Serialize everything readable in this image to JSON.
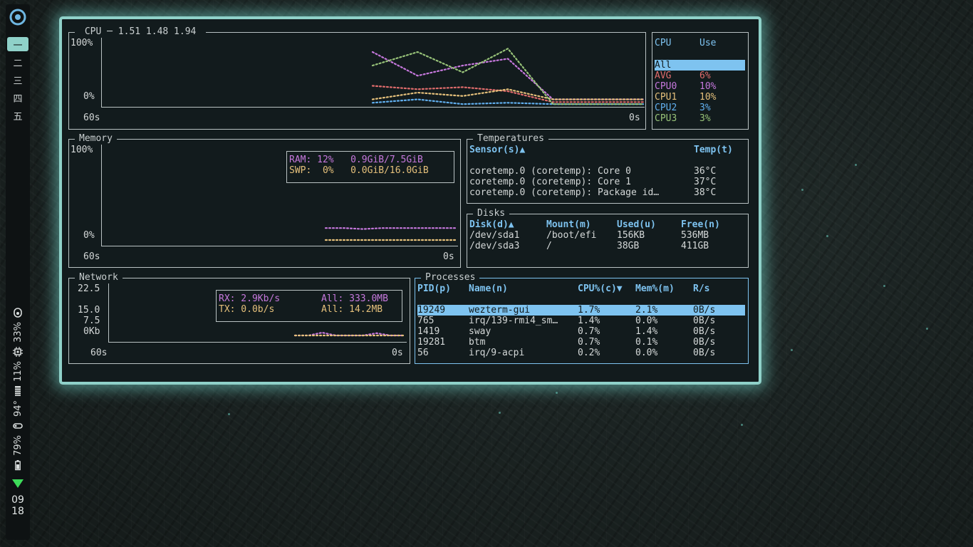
{
  "workspaces": [
    "一",
    "二",
    "三",
    "四",
    "五"
  ],
  "status": {
    "volume": "33%",
    "cpu": "11%",
    "temp": "94°",
    "battery": "79%",
    "clock_hour": "09",
    "clock_min": "18"
  },
  "cpu_panel": {
    "title": " CPU ─ 1.51 1.48 1.94 ",
    "y_top": "100%",
    "y_bottom": "0%",
    "x_left": "60s",
    "x_right": "0s",
    "legend_header": {
      "cpu": "CPU",
      "use": "Use"
    },
    "legend_all": "All",
    "legend_rows": [
      {
        "name": "AVG",
        "use": "6%",
        "color": "#e06c6c"
      },
      {
        "name": "CPU0",
        "use": "10%",
        "color": "#c678dd"
      },
      {
        "name": "CPU1",
        "use": "10%",
        "color": "#e5c07b"
      },
      {
        "name": "CPU2",
        "use": "3%",
        "color": "#61afef"
      },
      {
        "name": "CPU3",
        "use": "3%",
        "color": "#98c379"
      }
    ]
  },
  "memory_panel": {
    "title": "Memory",
    "y_top": "100%",
    "y_bottom": "0%",
    "x_left": "60s",
    "x_right": "0s",
    "ram": "RAM: 12%   0.9GiB/7.5GiB",
    "swp": "SWP:  0%   0.0GiB/16.0GiB",
    "ram_color": "#c678dd",
    "swp_color": "#e5c07b"
  },
  "temps_panel": {
    "title": "Temperatures",
    "header_sensor": "Sensor(s)▲",
    "header_temp": "Temp(t)",
    "rows": [
      {
        "sensor": "coretemp.0 (coretemp): Core 0",
        "temp": "36°C"
      },
      {
        "sensor": "coretemp.0 (coretemp): Core 1",
        "temp": "37°C"
      },
      {
        "sensor": "coretemp.0 (coretemp): Package id…",
        "temp": "38°C"
      }
    ]
  },
  "disks_panel": {
    "title": "Disks",
    "headers": {
      "disk": "Disk(d)▲",
      "mount": "Mount(m)",
      "used": "Used(u)",
      "free": "Free(n)"
    },
    "rows": [
      {
        "disk": "/dev/sda1",
        "mount": "/boot/efi",
        "used": "156KB",
        "free": "536MB"
      },
      {
        "disk": "/dev/sda3",
        "mount": "/",
        "used": "38GB",
        "free": "411GB"
      }
    ]
  },
  "network_panel": {
    "title": "Network",
    "y_labels": [
      "22.5",
      "15.0",
      "7.5",
      "0Kb"
    ],
    "x_left": "60s",
    "x_right": "0s",
    "rx": "RX: 2.9Kb/s",
    "tx": "TX: 0.0b/s",
    "rx_all": "All: 333.0MB",
    "tx_all": "All: 14.2MB",
    "rx_color": "#c678dd",
    "tx_color": "#e5c07b"
  },
  "processes_panel": {
    "title": "Processes",
    "headers": {
      "pid": "PID(p)",
      "name": "Name(n)",
      "cpu": "CPU%(c)▼",
      "mem": "Mem%(m)",
      "rs": "R/s"
    },
    "rows": [
      {
        "pid": "19249",
        "name": "wezterm-gui",
        "cpu": "1.7%",
        "mem": "2.1%",
        "rs": "0B/s"
      },
      {
        "pid": "765",
        "name": "irq/139-rmi4_sm…",
        "cpu": "1.4%",
        "mem": "0.0%",
        "rs": "0B/s"
      },
      {
        "pid": "1419",
        "name": "sway",
        "cpu": "0.7%",
        "mem": "1.4%",
        "rs": "0B/s"
      },
      {
        "pid": "19281",
        "name": "btm",
        "cpu": "0.7%",
        "mem": "0.1%",
        "rs": "0B/s"
      },
      {
        "pid": "56",
        "name": "irq/9-acpi",
        "cpu": "0.2%",
        "mem": "0.0%",
        "rs": "0B/s"
      }
    ]
  },
  "chart_data": [
    {
      "type": "line",
      "title": "CPU",
      "ylim": [
        0,
        100
      ],
      "x": [
        -60,
        -55,
        -50,
        -45,
        -40,
        -35,
        -30,
        -25,
        -20,
        -15,
        -10,
        -5,
        0
      ],
      "series": [
        {
          "name": "AVG",
          "values": [
            null,
            null,
            null,
            null,
            null,
            null,
            30,
            25,
            28,
            22,
            6,
            6,
            6
          ]
        },
        {
          "name": "CPU0",
          "values": [
            null,
            null,
            null,
            null,
            null,
            null,
            80,
            45,
            60,
            70,
            10,
            10,
            10
          ]
        },
        {
          "name": "CPU1",
          "values": [
            null,
            null,
            null,
            null,
            null,
            null,
            10,
            20,
            15,
            25,
            10,
            10,
            10
          ]
        },
        {
          "name": "CPU2",
          "values": [
            null,
            null,
            null,
            null,
            null,
            null,
            5,
            10,
            3,
            5,
            3,
            3,
            3
          ]
        },
        {
          "name": "CPU3",
          "values": [
            null,
            null,
            null,
            null,
            null,
            null,
            60,
            80,
            50,
            85,
            3,
            3,
            3
          ]
        }
      ]
    },
    {
      "type": "line",
      "title": "Memory",
      "ylim": [
        0,
        100
      ],
      "series": [
        {
          "name": "RAM",
          "values": [
            12,
            12,
            11,
            12,
            12,
            12,
            12,
            12
          ]
        },
        {
          "name": "SWP",
          "values": [
            0,
            0,
            0,
            0,
            0,
            0,
            0,
            0
          ]
        }
      ]
    },
    {
      "type": "line",
      "title": "Network",
      "ylim": [
        0,
        22.5
      ],
      "series": [
        {
          "name": "RX",
          "values": [
            0,
            0,
            0.5,
            0,
            0,
            0,
            0.4,
            0,
            0
          ]
        },
        {
          "name": "TX",
          "values": [
            0,
            0,
            0,
            0,
            0,
            0,
            0,
            0,
            0
          ]
        }
      ]
    }
  ]
}
